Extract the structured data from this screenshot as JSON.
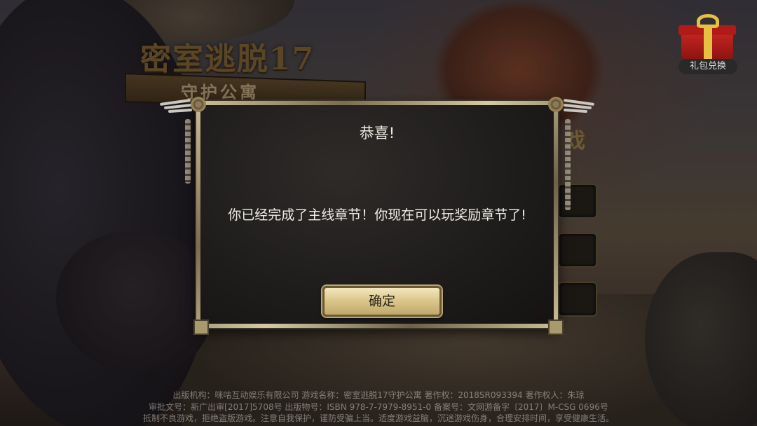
{
  "game": {
    "title": "密室逃脱17",
    "subtitle": "守护公寓",
    "partial_menu_glyph": "戏"
  },
  "gift": {
    "label": "礼包兑换",
    "icon": "gift-box-icon"
  },
  "dialog": {
    "title": "恭喜!",
    "message": "你已经完成了主线章节！你现在可以玩奖励章节了!",
    "confirm_label": "确定"
  },
  "footer": {
    "line1": "出版机构：咪咕互动娱乐有限公司 游戏名称：密室逃脱17守护公寓 著作权：2018SR093394 著作权人：朱琼",
    "line2": "审批文号：新广出审[2017]5708号 出版物号：ISBN 978-7-7979-8951-0 备案号：文网游备字〔2017〕M-CSG 0696号",
    "line3": "抵制不良游戏，拒绝盗版游戏。注意自我保护，谨防受骗上当。适度游戏益脑，沉迷游戏伤身，合理安排时间，享受健康生活。"
  },
  "colors": {
    "dialog_bg": "#1e1c1b",
    "frame": "#c9bd96",
    "button": "#dcc88e",
    "title_gold": "#8a6a3a"
  }
}
